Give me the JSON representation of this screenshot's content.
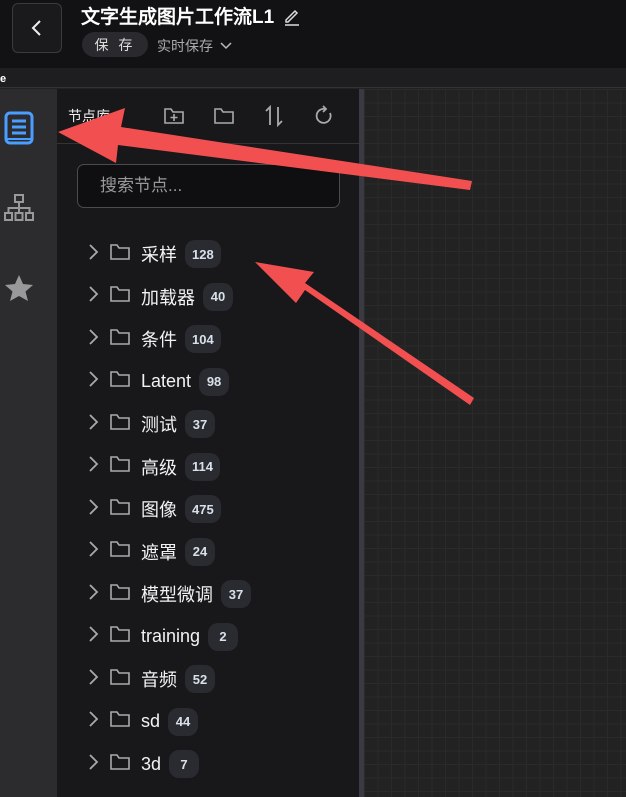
{
  "header": {
    "title": "文字生成图片工作流L1",
    "save_label": "保 存",
    "autosave_label": "实时保存"
  },
  "strip": {
    "text": "e"
  },
  "panel": {
    "title": "节点库",
    "search_placeholder": "搜索节点..."
  },
  "categories": [
    {
      "label": "采样",
      "count": "128"
    },
    {
      "label": "加载器",
      "count": "40"
    },
    {
      "label": "条件",
      "count": "104"
    },
    {
      "label": "Latent",
      "count": "98"
    },
    {
      "label": "测试",
      "count": "37"
    },
    {
      "label": "高级",
      "count": "114"
    },
    {
      "label": "图像",
      "count": "475"
    },
    {
      "label": "遮罩",
      "count": "24"
    },
    {
      "label": "模型微调",
      "count": "37"
    },
    {
      "label": "training",
      "count": "2"
    },
    {
      "label": "音频",
      "count": "52"
    },
    {
      "label": "sd",
      "count": "44"
    },
    {
      "label": "3d",
      "count": "7"
    }
  ],
  "colors": {
    "accent": "#4a9eff",
    "arrow": "#f25050"
  }
}
